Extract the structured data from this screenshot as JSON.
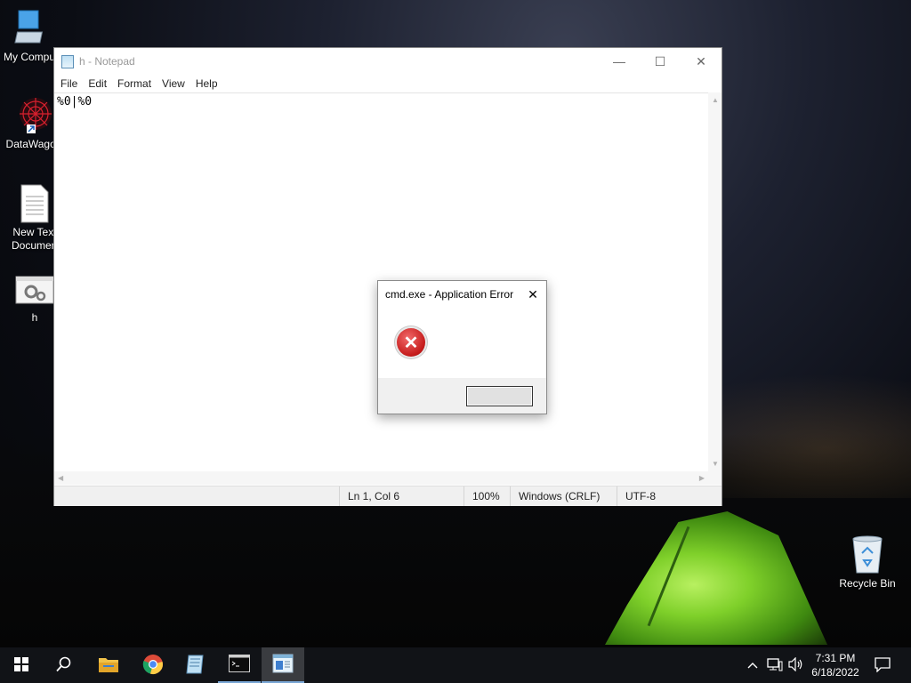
{
  "desktop": {
    "icons": [
      {
        "label": "My Compu"
      },
      {
        "label": "DataWagon"
      },
      {
        "label": "New Text Document"
      },
      {
        "label": "h"
      },
      {
        "label": "Recycle Bin"
      }
    ]
  },
  "notepad": {
    "title": "h - Notepad",
    "menu": [
      "File",
      "Edit",
      "Format",
      "View",
      "Help"
    ],
    "content": "%0|%0",
    "status": {
      "position": "Ln 1, Col 6",
      "zoom": "100%",
      "line_ending": "Windows (CRLF)",
      "encoding": "UTF-8"
    },
    "window_buttons": {
      "minimize": "—",
      "maximize": "☐",
      "close": "✕"
    }
  },
  "dialog": {
    "title": "cmd.exe - Application Error",
    "close": "✕",
    "icon": "error-icon",
    "ok_label": ""
  },
  "taskbar": {
    "time": "7:31 PM",
    "date": "6/18/2022",
    "items": [
      "start-icon",
      "search-icon",
      "file-explorer-icon",
      "chrome-icon",
      "notepad-pinned-icon",
      "cmd-icon",
      "notepad-icon"
    ]
  },
  "colors": {
    "accent": "#7aa7d6",
    "error": "#c41a1a",
    "tent": "#7fd02a"
  }
}
